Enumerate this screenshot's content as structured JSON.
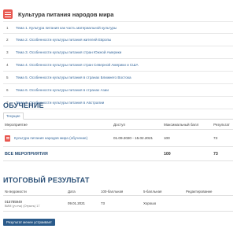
{
  "course": {
    "title": "Культура питания народов мира",
    "icon": "book-icon"
  },
  "topics": [
    {
      "num": "1",
      "label": "Тема 1. Культура питания как часть материальной культуры"
    },
    {
      "num": "2",
      "label": "Тема 2. Особенности культуры питания жителей Европы"
    },
    {
      "num": "3",
      "label": "Тема 3. Особенности культуры питания стран Южной Америки"
    },
    {
      "num": "4",
      "label": "Тема 4. Особенности культуры питания стран Северной Америки и США"
    },
    {
      "num": "5",
      "label": "Тема 5. Особенности культуры питания в странах Ближнего Востока"
    },
    {
      "num": "6",
      "label": "Тема 6. Особенности культуры питания в странах Азии"
    },
    {
      "num": "7",
      "label": "Тема 7. Особенности культуры питания в Австралии"
    }
  ],
  "education": {
    "title": "ОБУЧЕНИЕ",
    "tab_current": "Текущие",
    "headers": {
      "event": "Мероприятие",
      "access": "Доступ",
      "max_score": "Максимальный балл",
      "result": "Результат"
    },
    "rows": [
      {
        "event": "Культура питания народов мира (обучение)",
        "access": "01.09.2020 - 15.02.2021",
        "max_score": "100",
        "result": "73"
      }
    ],
    "total": {
      "label": "ВСЕ МЕРОПРИЯТИЯ",
      "max_score": "100",
      "result": "73"
    }
  },
  "final_result": {
    "title": "ИТОГОВЫЙ РЕЗУЛЬТАТ",
    "headers": {
      "record": "№ ведомости",
      "date": "Дата",
      "score100": "100-балльная",
      "score5": "5-балльная",
      "edited": "Редактирование"
    },
    "rows": [
      {
        "record": "015785949",
        "record_sub": "ВИМ (уч.тчк) (Отрыть) 17",
        "date": "09.01.2021",
        "score100": "73",
        "score5": "Хорошо",
        "edited": ""
      }
    ],
    "button": "Результат менее устраивает"
  },
  "colors": {
    "accent": "#2a4f76",
    "link": "#3a6b9e",
    "icon": "#e8564f",
    "button": "#2a5a8a"
  }
}
